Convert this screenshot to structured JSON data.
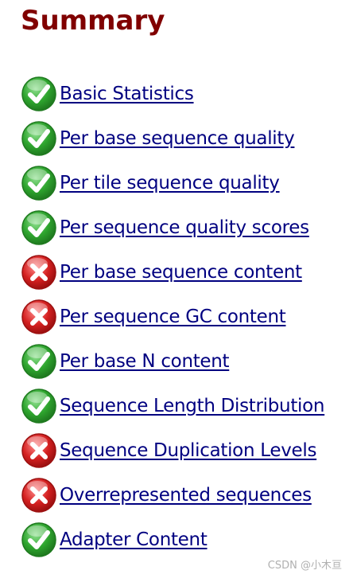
{
  "summary": {
    "title": "Summary",
    "modules": [
      {
        "label": "Basic Statistics",
        "status": "pass",
        "icon": "pass-check-icon"
      },
      {
        "label": "Per base sequence quality",
        "status": "pass",
        "icon": "pass-check-icon"
      },
      {
        "label": "Per tile sequence quality",
        "status": "pass",
        "icon": "pass-check-icon"
      },
      {
        "label": "Per sequence quality scores",
        "status": "pass",
        "icon": "pass-check-icon"
      },
      {
        "label": "Per base sequence content",
        "status": "fail",
        "icon": "fail-cross-icon"
      },
      {
        "label": "Per sequence GC content",
        "status": "fail",
        "icon": "fail-cross-icon"
      },
      {
        "label": "Per base N content",
        "status": "pass",
        "icon": "pass-check-icon"
      },
      {
        "label": "Sequence Length Distribution",
        "status": "pass",
        "icon": "pass-check-icon"
      },
      {
        "label": "Sequence Duplication Levels",
        "status": "fail",
        "icon": "fail-cross-icon"
      },
      {
        "label": "Overrepresented sequences",
        "status": "fail",
        "icon": "fail-cross-icon"
      },
      {
        "label": "Adapter Content",
        "status": "pass",
        "icon": "pass-check-icon"
      }
    ]
  },
  "colors": {
    "title": "#800000",
    "link": "#000080",
    "pass": "#2ea52e",
    "fail": "#d42020"
  },
  "watermark": "CSDN @小木亘"
}
